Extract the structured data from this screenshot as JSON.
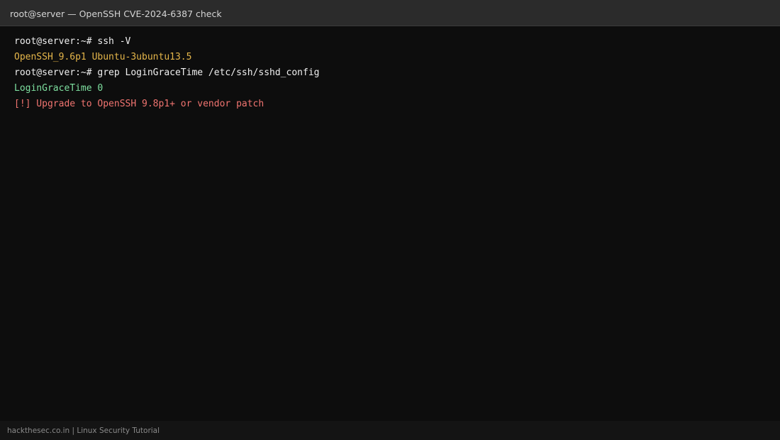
{
  "window": {
    "title": "root@server — OpenSSH CVE-2024-6387 check"
  },
  "terminal": {
    "lines": [
      {
        "text": "root@server:~# ssh -V",
        "color": "#f0f0f0"
      },
      {
        "text": "OpenSSH_9.6p1 Ubuntu-3ubuntu13.5",
        "color": "#e5b64a"
      },
      {
        "text": "root@server:~# grep LoginGraceTime /etc/ssh/sshd_config",
        "color": "#f0f0f0"
      },
      {
        "text": "LoginGraceTime 0",
        "color": "#7ee0a0"
      },
      {
        "text": "[!] Upgrade to OpenSSH 9.8p1+ or vendor patch",
        "color": "#f07470"
      }
    ]
  },
  "footer": {
    "text": "hackthesec.co.in | Linux Security Tutorial"
  }
}
